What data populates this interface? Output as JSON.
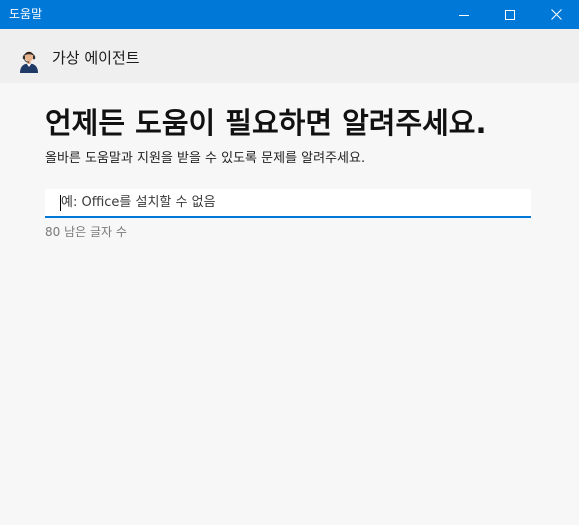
{
  "window": {
    "title": "도움말",
    "controls": [
      "minimize-icon",
      "maximize-icon",
      "close-icon"
    ]
  },
  "agent": {
    "name": "가상 에이전트",
    "avatar_icon": "agent-avatar-icon"
  },
  "main": {
    "headline": "언제든 도움이 필요하면 알려주세요.",
    "subtitle": "올바른 도움말과 지원을 받을 수 있도록 문제를 알려주세요.",
    "input": {
      "value": "",
      "placeholder": "예: Office를 설치할 수 없음"
    },
    "char_counter": "80 남은 글자 수"
  },
  "colors": {
    "accent": "#0078d7",
    "background": "#f7f7f7",
    "agent_bar": "#efefef"
  }
}
